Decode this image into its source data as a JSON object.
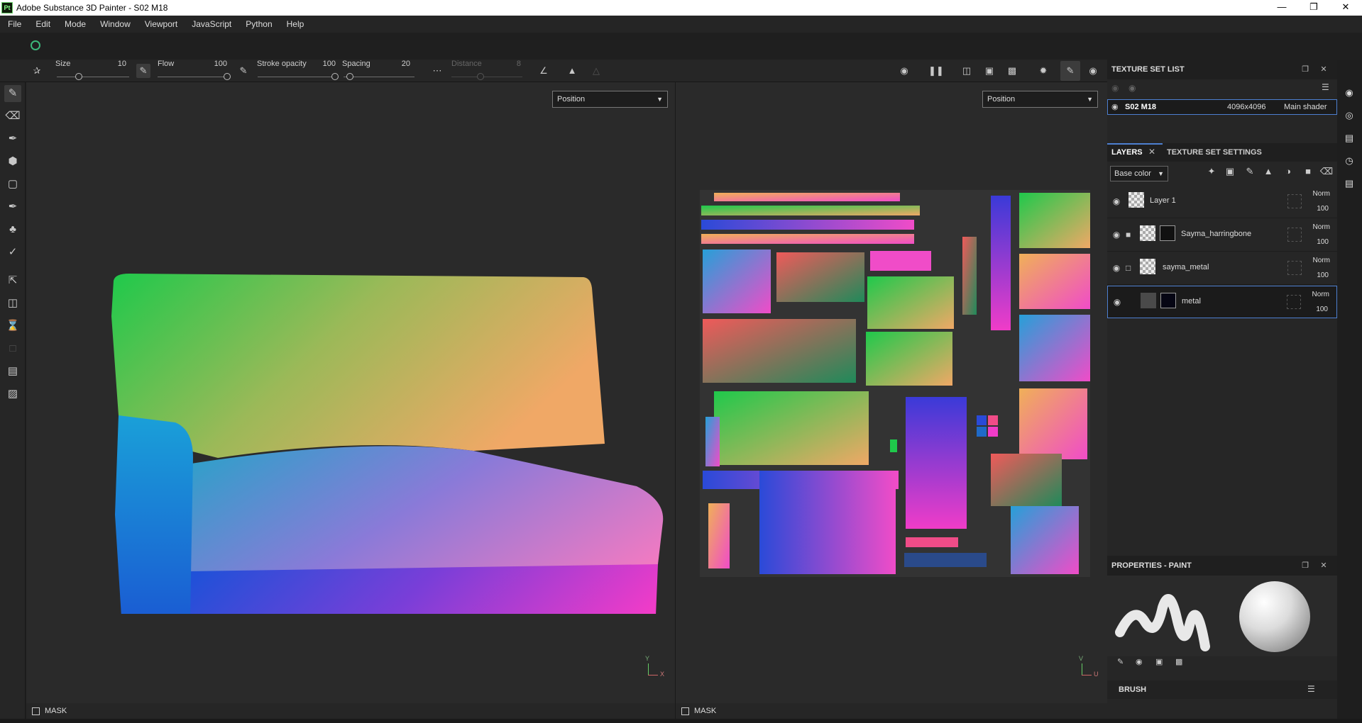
{
  "window": {
    "title": "Adobe Substance 3D Painter - S02 M18",
    "app_logo": "Pt"
  },
  "menu": [
    "File",
    "Edit",
    "Mode",
    "Window",
    "Viewport",
    "JavaScript",
    "Python",
    "Help"
  ],
  "toolbar": {
    "size_label": "Size",
    "size_value": "10",
    "flow_label": "Flow",
    "flow_value": "100",
    "stroke_opacity_label": "Stroke opacity",
    "stroke_opacity_value": "100",
    "spacing_label": "Spacing",
    "spacing_value": "20",
    "distance_label": "Distance",
    "distance_value": "8"
  },
  "viewports": {
    "left": {
      "mode": "Position",
      "mask_label": "MASK",
      "axis_y": "Y",
      "axis_x": "X"
    },
    "right": {
      "mode": "Position",
      "mask_label": "MASK",
      "axis_v": "V",
      "axis_u": "U"
    }
  },
  "texture_set_list": {
    "title": "TEXTURE SET LIST",
    "item": {
      "name": "S02 M18",
      "resolution": "4096x4096",
      "shader": "Main shader"
    }
  },
  "layers_panel": {
    "tabs": [
      "LAYERS",
      "TEXTURE SET SETTINGS"
    ],
    "channel": "Base color",
    "layers": [
      {
        "name": "Layer 1",
        "blend": "Norm",
        "opacity": "100"
      },
      {
        "name": "Sayma_harringbone",
        "blend": "Norm",
        "opacity": "100"
      },
      {
        "name": "sayma_metal",
        "blend": "Norm",
        "opacity": "100"
      },
      {
        "name": "metal",
        "blend": "Norm",
        "opacity": "100"
      }
    ]
  },
  "properties": {
    "title": "PROPERTIES - PAINT",
    "brush_label": "BRUSH"
  },
  "colors": {
    "accent": "#4d7fd0",
    "panel": "#262626",
    "viewport": "#2a2a2a"
  }
}
